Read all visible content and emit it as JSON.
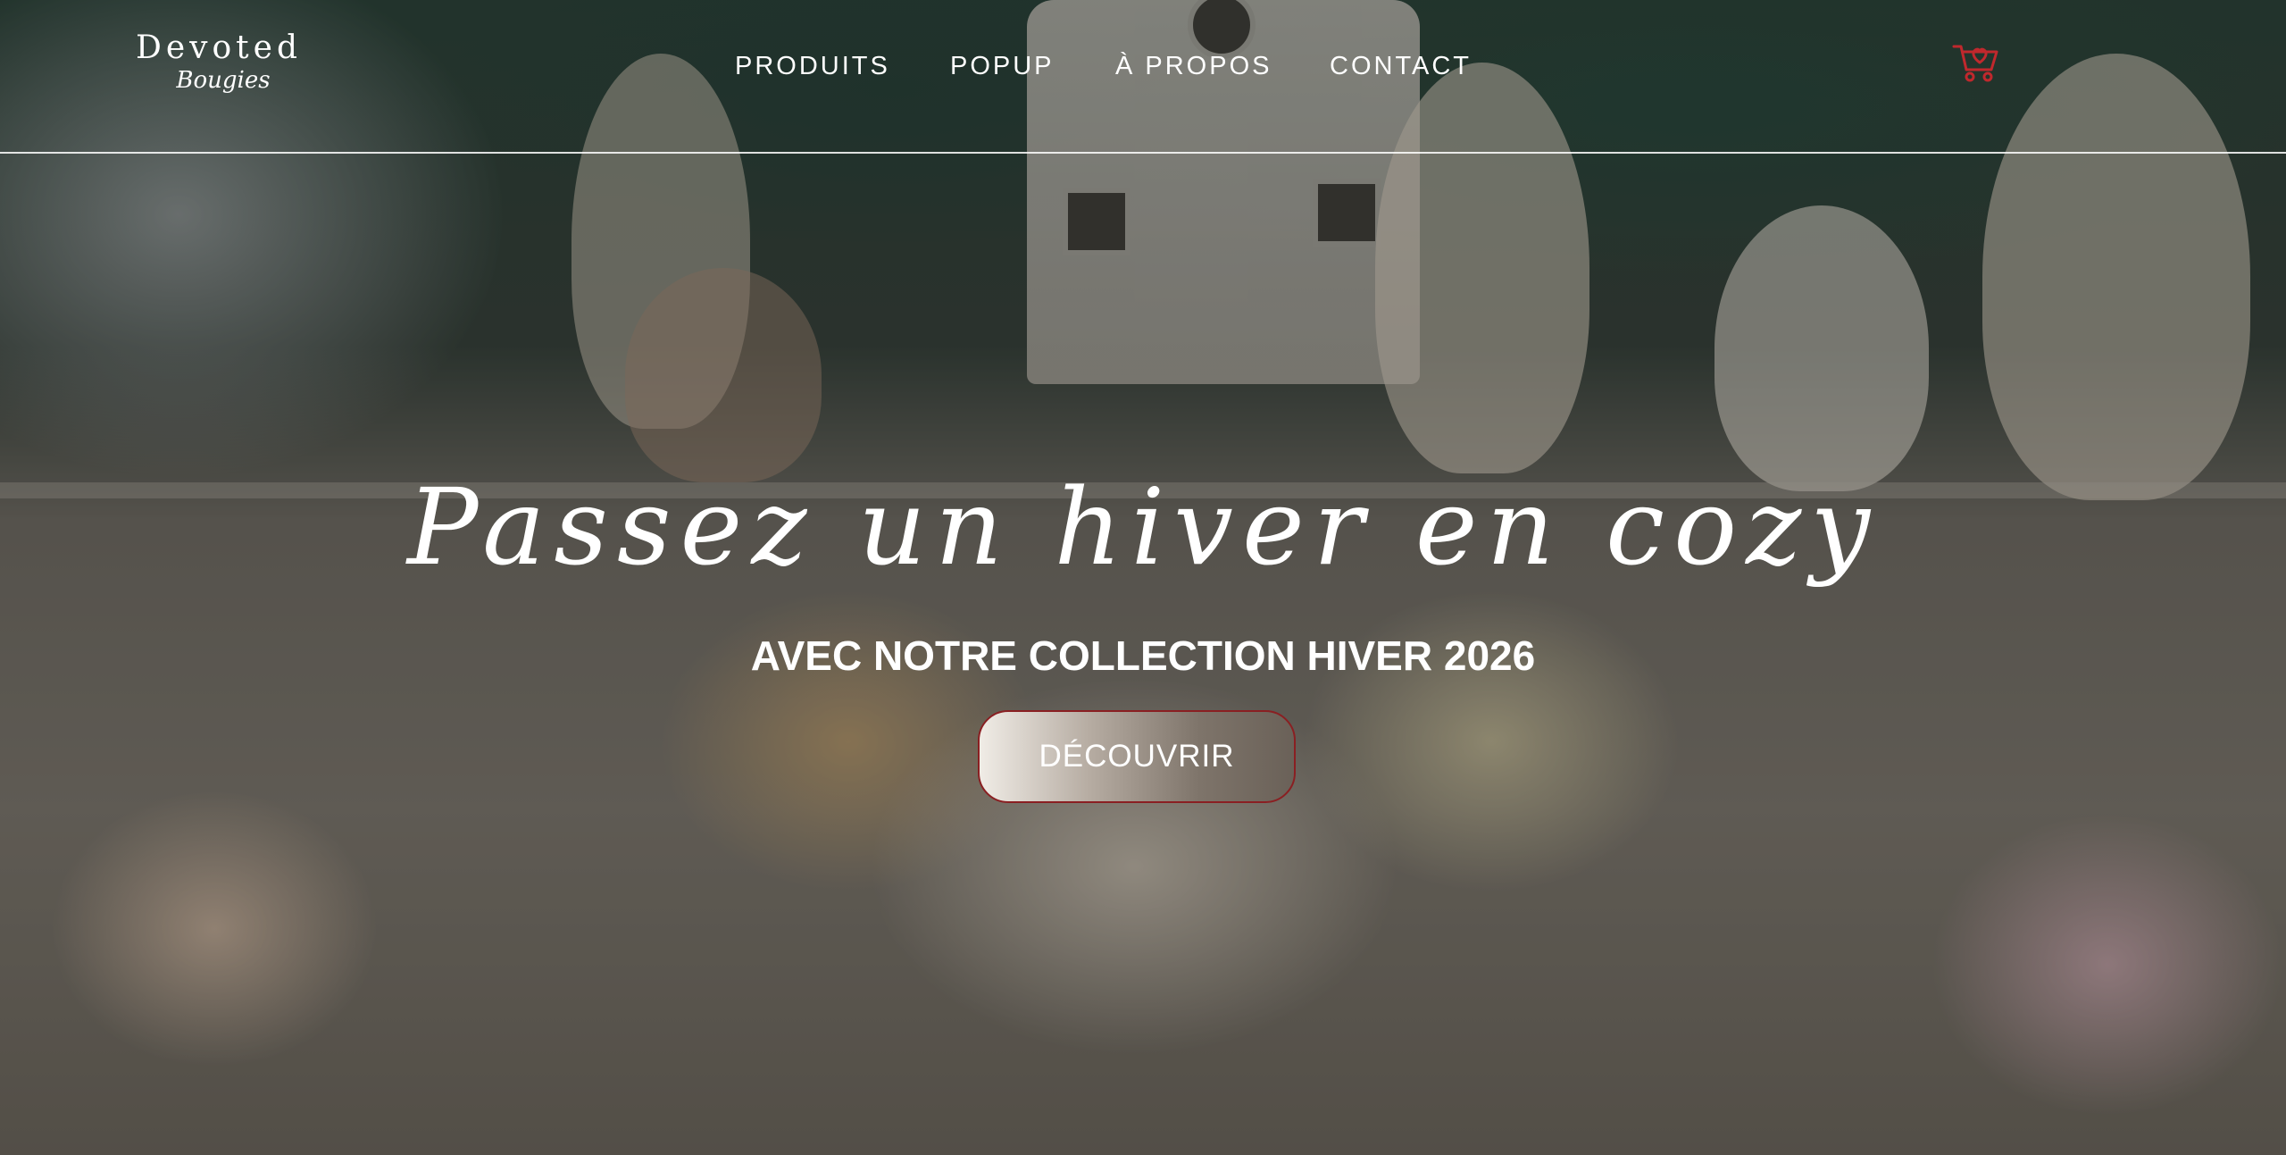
{
  "brand": {
    "name": "Devoted",
    "tagline": "Bougies"
  },
  "nav": {
    "items": [
      {
        "label": "PRODUITS"
      },
      {
        "label": "POPUP"
      },
      {
        "label": "À PROPOS"
      },
      {
        "label": "CONTACT"
      }
    ]
  },
  "cart": {
    "icon": "shopping-cart-heart-icon",
    "color": "#c0282d"
  },
  "hero": {
    "script_title": "Passez un hiver en cozy",
    "subtitle": "AVEC NOTRE COLLECTION HIVER 2026",
    "cta_label": "DÉCOUVRIR",
    "cta_border_color": "#8a1f22",
    "background_image": "winter candles collection photo (dimmed)"
  }
}
